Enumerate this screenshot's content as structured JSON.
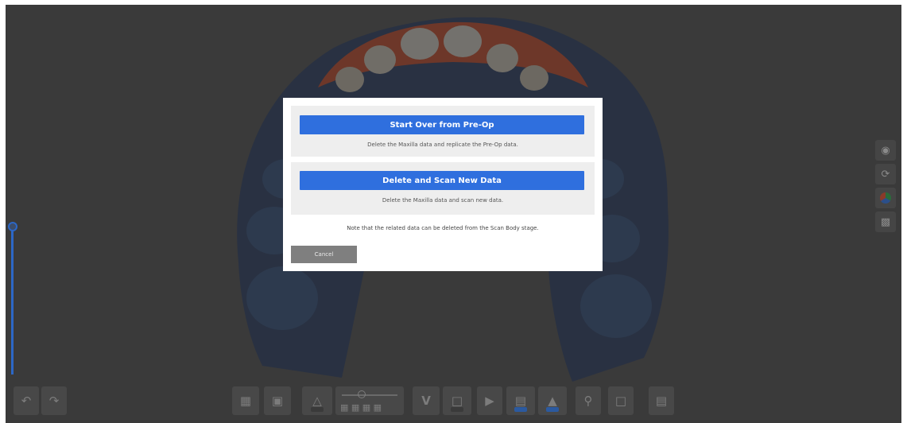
{
  "dialog": {
    "option1": {
      "button_label": "Start Over from Pre-Op",
      "description": "Delete the Maxilla data and replicate the Pre-Op data."
    },
    "option2": {
      "button_label": "Delete and Scan New Data",
      "description": "Delete the Maxilla data and scan new data."
    },
    "note": "Note that the related data can be deleted from the Scan Body stage.",
    "cancel_label": "Cancel"
  },
  "colors": {
    "primary_button": "#2f6fde",
    "slider": "#2c67c6",
    "cancel_button": "#7f7f7f",
    "gingiva": "#c24a2a",
    "arch_model": "#2a3c5e"
  },
  "right_toolbar": {
    "icons": [
      "camera-icon",
      "rotate-icon",
      "color-mode-icon",
      "texture-icon"
    ]
  },
  "bottom_toolbar": {
    "left_icons": [
      "undo-icon",
      "redo-icon"
    ],
    "icons": [
      "scan-area-icon",
      "lock-area-icon",
      "filter-icon",
      "depth-slider-icon",
      "v-mode-icon",
      "scan-frame-icon",
      "play-icon",
      "data-view-icon",
      "scan-body-icon",
      "search-icon",
      "delete-icon",
      "report-icon"
    ]
  }
}
